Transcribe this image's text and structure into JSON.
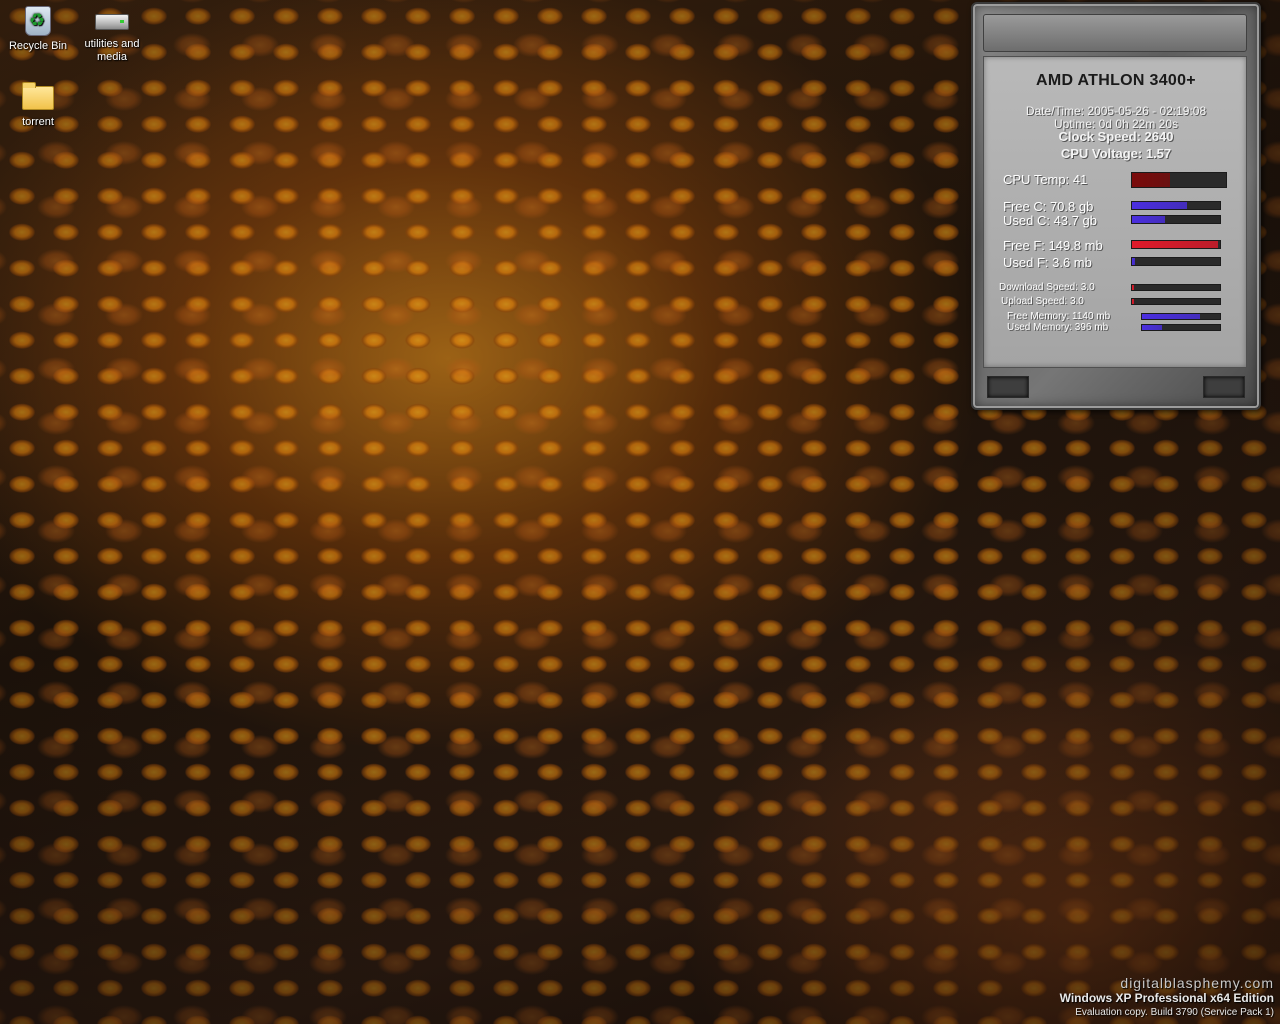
{
  "desktop": {
    "icons": [
      {
        "label": "Recycle Bin",
        "icon": "recycle-bin-icon"
      },
      {
        "label": "utilities and media",
        "icon": "drive-icon"
      },
      {
        "label": "torrent",
        "icon": "folder-icon"
      }
    ]
  },
  "widget": {
    "title": "AMD ATHLON 3400+",
    "datetime": "Date/Time: 2005-05-26 - 02:19:08",
    "uptime": "Uptime: 0d 0h 22m 20s",
    "clock": "Clock Speed: 2640",
    "voltage": "CPU Voltage: 1.57",
    "cpu_temp": {
      "label": "CPU Temp: 41",
      "fill": 0.4
    },
    "free_c": {
      "label": "Free C: 70.8 gb",
      "fill": 0.62
    },
    "used_c": {
      "label": "Used C: 43.7 gb",
      "fill": 0.38
    },
    "free_f": {
      "label": "Free F: 149.8 mb",
      "fill": 0.98
    },
    "used_f": {
      "label": "Used F: 3.6 mb",
      "fill": 0.03
    },
    "download": {
      "label": "Download Speed: 3.0",
      "fill": 0.02
    },
    "upload": {
      "label": "Upload Speed: 3.0",
      "fill": 0.02
    },
    "free_mem": {
      "label": "Free Memory: 1140 mb",
      "fill": 0.74
    },
    "used_mem": {
      "label": "Used Memory: 396 mb",
      "fill": 0.26
    }
  },
  "branding": {
    "site": "digitalblasphemy.com",
    "os": "Windows XP Professional x64 Edition",
    "build": "Evaluation copy. Build 3790 (Service Pack 1)"
  },
  "colors": {
    "bar_cool": "#4a2ee0",
    "bar_hot": "#e01a2a",
    "bar_temp": "#7a0a0a"
  }
}
